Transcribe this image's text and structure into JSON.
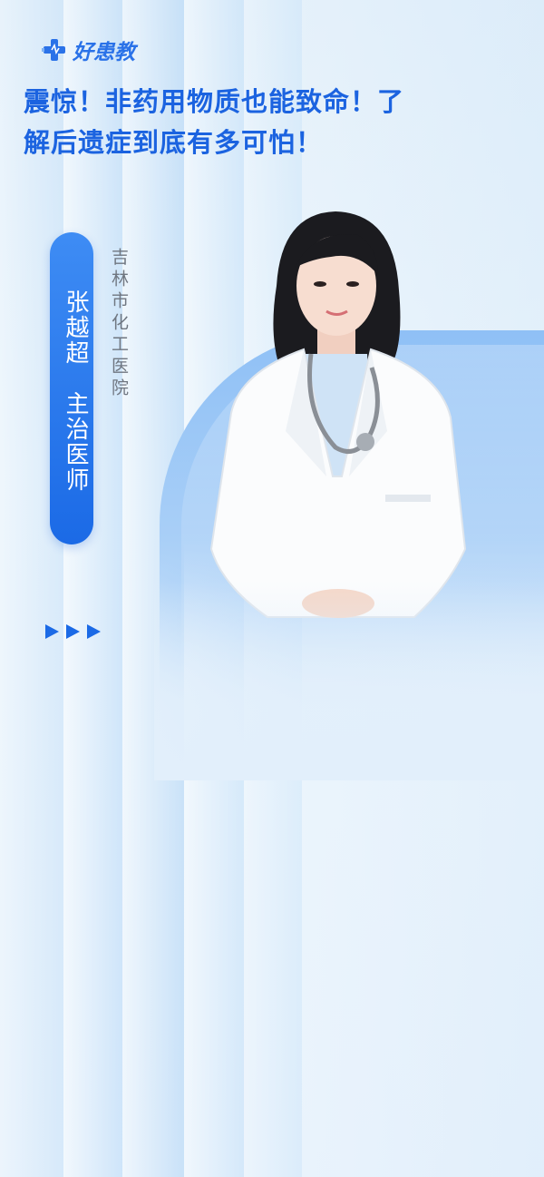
{
  "brand": {
    "name": "好患教",
    "icon": "plus-chart-logo-icon",
    "color": "#2a72e8"
  },
  "headline": {
    "line1": "震惊！非药用物质也能致命！了",
    "line2": "解后遗症到底有多可怕！",
    "color": "#1b63e0"
  },
  "doctor": {
    "name": "张越超",
    "title": "主治医师",
    "pill_text": "张越超　主治医师",
    "hospital": "吉林市化工医院"
  },
  "decor": {
    "arrow_icon": "play-arrow-icon",
    "accent": "#1b6ae6",
    "background": "#e2effb"
  }
}
